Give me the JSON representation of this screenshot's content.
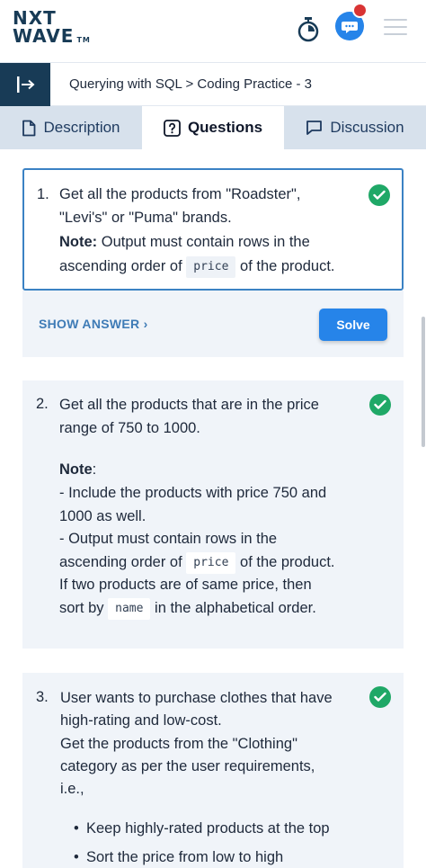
{
  "header": {
    "logo_line1": "NXT",
    "logo_line2": "WAVE",
    "logo_tm": "TM",
    "icons": [
      "timer-icon",
      "chat-icon",
      "notification-dot",
      "hamburger-menu-icon"
    ]
  },
  "breadcrumb": {
    "text": "Querying with SQL > Coding Practice - 3"
  },
  "tabs": [
    {
      "label": "Description",
      "icon": "document-icon",
      "active": false
    },
    {
      "label": "Questions",
      "icon": "question-icon",
      "active": true
    },
    {
      "label": "Discussion",
      "icon": "chat-bubble-icon",
      "active": false
    }
  ],
  "questions": [
    {
      "number": "1.",
      "line1": "Get all the products from \"Roadster\",",
      "line2": "\"Levi's\" or \"Puma\" brands.",
      "note_label": "Note:",
      "note_rest": " Output must contain rows in the",
      "line4a": "ascending order of",
      "code": "price",
      "line4b": "of the product.",
      "completed": true
    },
    {
      "number": "2.",
      "line1": "Get all the products that are in the price",
      "line2": "range of 750 to 1000.",
      "note_label": "Note",
      "note_colon": ":",
      "line4": "-  Include the products with price 750 and",
      "line5": "1000 as well.",
      "line6": "-  Output must contain rows in the",
      "line7a": "ascending order of",
      "code1": "price",
      "line7b": "of the product.",
      "line8": "If two products are of same price, then",
      "line9a": "sort by",
      "code2": "name",
      "line9b": "in the alphabetical order.",
      "completed": true
    },
    {
      "number": "3.",
      "line1": "User wants to purchase clothes that have",
      "line2": "high-rating and low-cost.",
      "line3": "Get the products from the \"Clothing\"",
      "line4": "category as per the user requirements,",
      "line5": "i.e.,",
      "bullets": [
        "Keep highly-rated products at the top",
        "Sort the price from low to high"
      ],
      "completed": true
    }
  ],
  "actions": {
    "show_answer": "SHOW ANSWER",
    "solve": "Solve"
  },
  "colors": {
    "brand_dark": "#183b56",
    "accent_blue": "#2684e9",
    "success_green": "#1fa867",
    "badge_red": "#d93434"
  }
}
